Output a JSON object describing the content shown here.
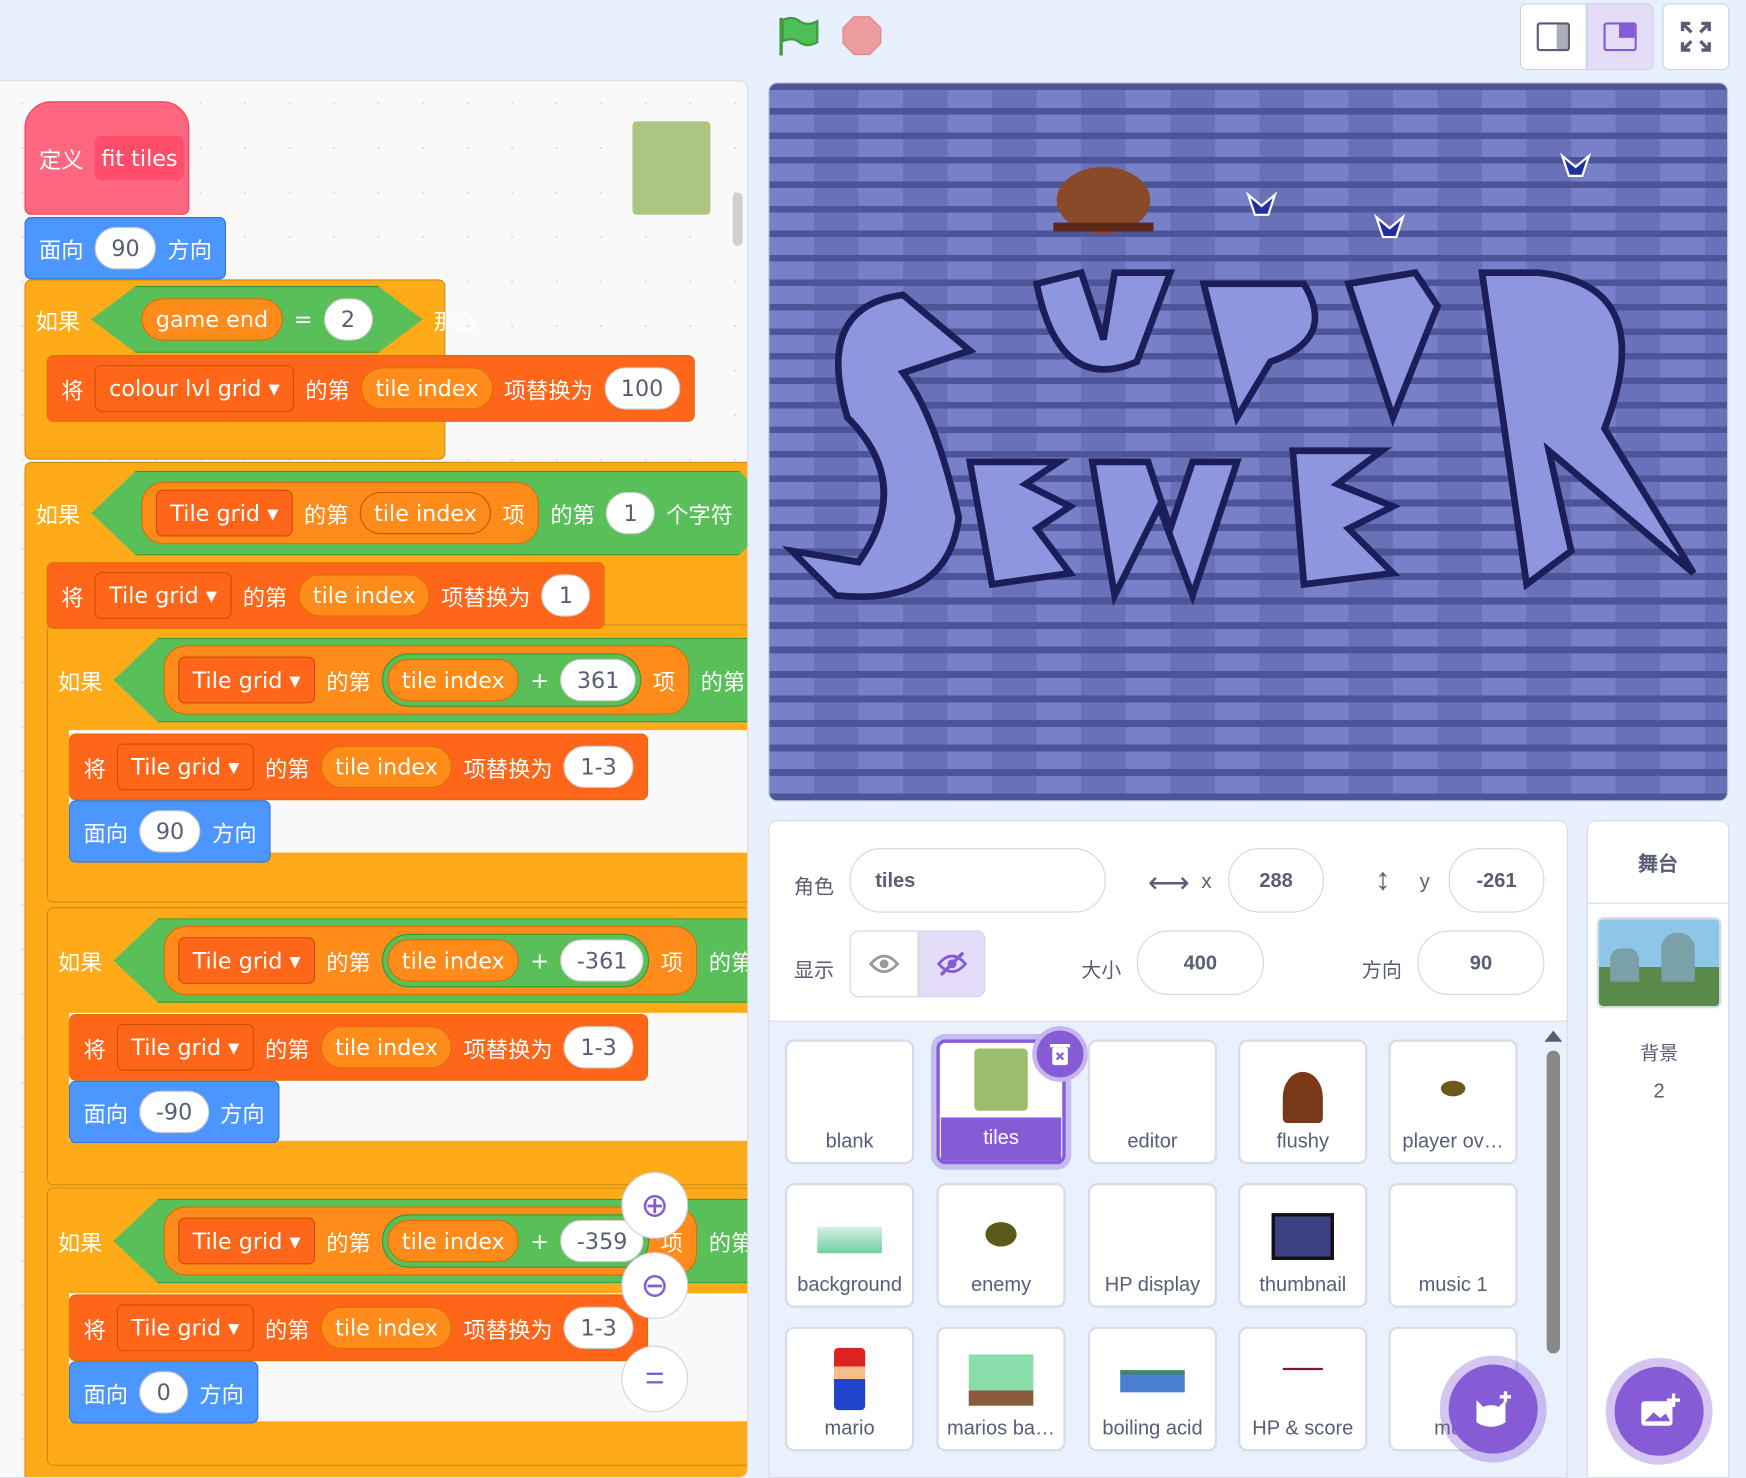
{
  "stage_controls": {
    "green_flag": "green-flag-icon",
    "stop": "stop-icon"
  },
  "script": {
    "define_label": "定义",
    "define_name": "fit tiles",
    "face_label": "面向",
    "dir_label": "方向",
    "face1_val": "90",
    "if_label": "如果",
    "then_label": "那么",
    "game_end": "game end",
    "eq": "=",
    "eq_val": "2",
    "replace_label": "将",
    "of_label": "的第",
    "replace_with": "项替换为",
    "item_label": "项",
    "char_label": "个字符",
    "colour_grid": "colour lvl grid",
    "tile_index": "tile index",
    "val_100": "100",
    "tile_grid": "Tile grid",
    "val_1": "1",
    "plus": "+",
    "v361": "361",
    "vm361": "-361",
    "vm359": "-359",
    "v13": "1-3",
    "face2": "90",
    "face3": "-90",
    "face4": "0"
  },
  "sprite_info": {
    "sprite_label": "角色",
    "sprite_name": "tiles",
    "x_label": "x",
    "x_val": "288",
    "y_label": "y",
    "y_val": "-261",
    "show_label": "显示",
    "size_label": "大小",
    "size_val": "400",
    "dir_label": "方向",
    "dir_val": "90"
  },
  "sprites": [
    "blank",
    "tiles",
    "editor",
    "flushy",
    "player ov…",
    "background",
    "enemy",
    "HP display",
    "thumbnail",
    "music 1",
    "mario",
    "marios ba…",
    "boiling acid",
    "HP & score",
    "mus"
  ],
  "stage_panel": {
    "title": "舞台",
    "backdrops_label": "背景",
    "backdrops_count": "2"
  },
  "colors": {
    "accent": "#855cd6",
    "motion": "#4c97ff",
    "control": "#ffab19",
    "data": "#ff661a",
    "operator": "#59c059",
    "bg": "#e6f0ff"
  }
}
